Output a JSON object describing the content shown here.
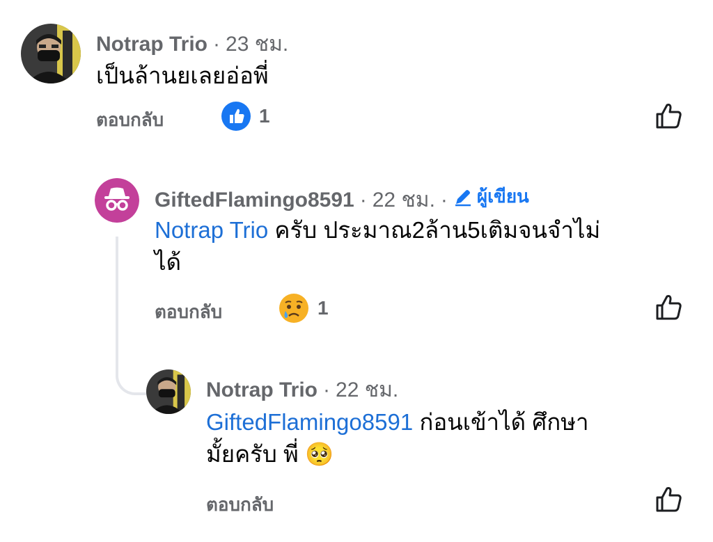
{
  "comments": [
    {
      "author": "Notrap Trio",
      "separator": "·",
      "time": "23 ชม.",
      "text": "เป็นล้านยเลยอ่อพี่",
      "reply_label": "ตอบกลับ",
      "reaction_icon": "like-reaction-icon",
      "reaction_count": "1"
    },
    {
      "author": "GiftedFlamingo8591",
      "separator": "·",
      "time": "22 ชม.",
      "separator2": "·",
      "author_badge": "ผู้เขียน",
      "mention": "Notrap Trio",
      "text_line1": " ครับ ประมาณ2ล้าน5เติมจนจำไม่",
      "text_line2": "ได้",
      "reply_label": "ตอบกลับ",
      "reaction_icon": "sad-reaction-icon",
      "reaction_count": "1"
    },
    {
      "author": "Notrap Trio",
      "separator": "·",
      "time": "22 ชม.",
      "mention": "GiftedFlamingo8591",
      "text_line1": " ก่อนเข้าได้ ศึกษา",
      "text_line2": "มั้ยครับ พี่ ",
      "emoji": "🥺",
      "reply_label": "ตอบกลับ"
    }
  ],
  "colors": {
    "secondary_text": "#65676b",
    "mention": "#1d6fd6",
    "like_blue": "#1877f2",
    "incognito_bg": "#c3409a"
  }
}
